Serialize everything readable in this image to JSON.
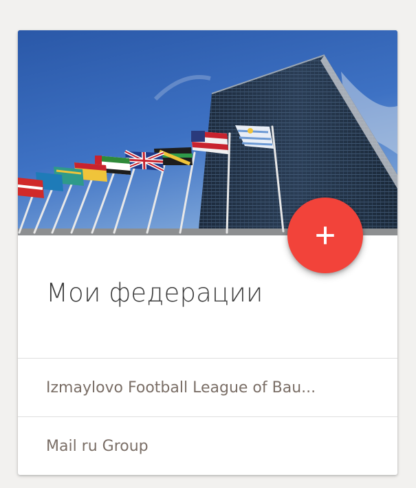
{
  "card": {
    "title": "Мои федерации",
    "add_button_icon": "plus-icon",
    "items": [
      {
        "label": "Izmaylovo Football League of Bau..."
      },
      {
        "label": "Mail ru Group"
      }
    ]
  },
  "colors": {
    "accent": "#f2433a",
    "title_text": "#3d3d3d",
    "item_text": "#7a6e66",
    "page_background": "#f2f1ef"
  }
}
